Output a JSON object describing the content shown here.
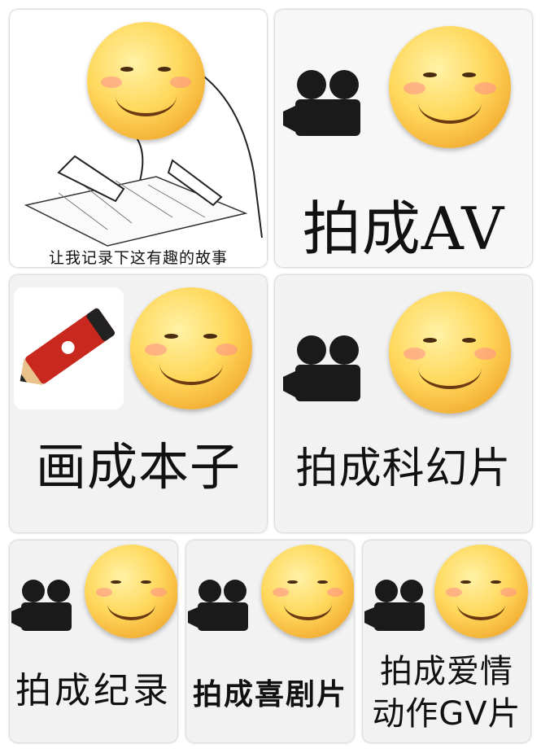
{
  "tiles": [
    {
      "caption": "让我记录下这有趣的故事",
      "icons": [
        "smiley-face",
        "hand-writing-sketch"
      ]
    },
    {
      "caption": "拍成AV",
      "icons": [
        "movie-camera",
        "smiley-face"
      ]
    },
    {
      "caption": "画成本子",
      "icons": [
        "red-pencil",
        "smiley-face"
      ]
    },
    {
      "caption": "拍成科幻片",
      "icons": [
        "movie-camera",
        "smiley-face"
      ]
    },
    {
      "caption": "拍成纪录",
      "icons": [
        "movie-camera",
        "smiley-face"
      ]
    },
    {
      "caption": "拍成喜剧片",
      "icons": [
        "movie-camera",
        "smiley-face"
      ]
    },
    {
      "caption_lines": [
        "拍成爱情",
        "动作GV片"
      ],
      "icons": [
        "movie-camera",
        "smiley-face"
      ]
    }
  ],
  "colors": {
    "tile_bg": "#f2f2f2",
    "face": "#ffd85c",
    "camera": "#1a1a1a",
    "pencil": "#c8281e"
  }
}
